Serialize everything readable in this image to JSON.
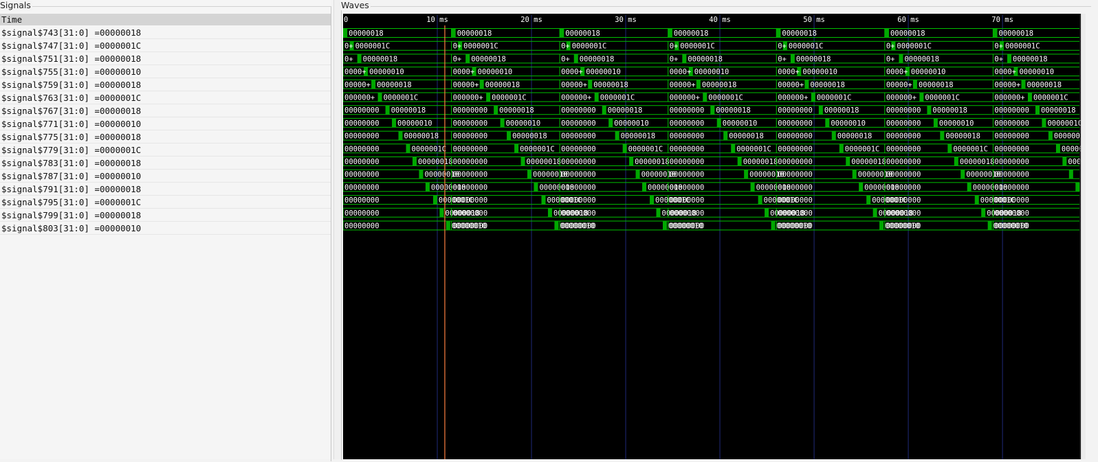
{
  "signals_panel": {
    "title": "Signals",
    "time_label": "Time",
    "rows": [
      {
        "name": "$signal$743[31:0]",
        "value": "=00000018"
      },
      {
        "name": "$signal$747[31:0]",
        "value": "=0000001C"
      },
      {
        "name": "$signal$751[31:0]",
        "value": "=00000018"
      },
      {
        "name": "$signal$755[31:0]",
        "value": "=00000010"
      },
      {
        "name": "$signal$759[31:0]",
        "value": "=00000018"
      },
      {
        "name": "$signal$763[31:0]",
        "value": "=0000001C"
      },
      {
        "name": "$signal$767[31:0]",
        "value": "=00000018"
      },
      {
        "name": "$signal$771[31:0]",
        "value": "=00000010"
      },
      {
        "name": "$signal$775[31:0]",
        "value": "=00000018"
      },
      {
        "name": "$signal$779[31:0]",
        "value": "=0000001C"
      },
      {
        "name": "$signal$783[31:0]",
        "value": "=00000018"
      },
      {
        "name": "$signal$787[31:0]",
        "value": "=00000010"
      },
      {
        "name": "$signal$791[31:0]",
        "value": "=00000018"
      },
      {
        "name": "$signal$795[31:0]",
        "value": "=0000001C"
      },
      {
        "name": "$signal$799[31:0]",
        "value": "=00000018"
      },
      {
        "name": "$signal$803[31:0]",
        "value": "=00000010"
      }
    ]
  },
  "waves_panel": {
    "title": "Waves",
    "timeline": {
      "start_label": "0",
      "unit": "ms",
      "ticks": [
        "10 ms",
        "20 ms",
        "30 ms",
        "40 ms",
        "50 ms",
        "60 ms",
        "70 ms"
      ],
      "tick_values": [
        10,
        20,
        30,
        40,
        50,
        60,
        70
      ],
      "visible_range_ms": [
        0,
        77
      ],
      "cycle_ms": 11.5,
      "cursor_ms": 10.8
    },
    "zero_value": "00000000",
    "traces": [
      {
        "value": "00000018",
        "short": "0+",
        "transition_phase": 0.02
      },
      {
        "value": "0000001C",
        "short": "0+",
        "transition_phase": 0.08
      },
      {
        "value": "00000018",
        "short": "0+",
        "transition_phase": 0.15
      },
      {
        "value": "00000010",
        "short": "0000+",
        "transition_phase": 0.21
      },
      {
        "value": "00000018",
        "short": "00000+",
        "transition_phase": 0.28
      },
      {
        "value": "0000001C",
        "short": "000000+",
        "transition_phase": 0.34
      },
      {
        "value": "00000018",
        "short": "00000000",
        "transition_phase": 0.41
      },
      {
        "value": "00000010",
        "short": "00000000",
        "transition_phase": 0.47
      },
      {
        "value": "00000018",
        "short": "00000000",
        "transition_phase": 0.53
      },
      {
        "value": "0000001C",
        "short": "00000000",
        "transition_phase": 0.6
      },
      {
        "value": "00000018",
        "short": "00000000",
        "transition_phase": 0.66
      },
      {
        "value": "00000010",
        "short": "00000000",
        "transition_phase": 0.72
      },
      {
        "value": "00000018",
        "short": "000000+",
        "transition_phase": 0.78
      },
      {
        "value": "0000001C",
        "short": "0000+",
        "transition_phase": 0.85
      },
      {
        "value": "00000018",
        "short": "000+",
        "transition_phase": 0.91
      },
      {
        "value": "00000010",
        "short": "0+",
        "transition_phase": 0.97
      }
    ],
    "colors": {
      "background": "#000000",
      "trace": "#00c000",
      "trace_fill": "#00a800",
      "text": "#ffffff",
      "grid": "#1f2a7a",
      "cursor": "#ff7f3f",
      "timeline_text": "#ffffff"
    }
  }
}
